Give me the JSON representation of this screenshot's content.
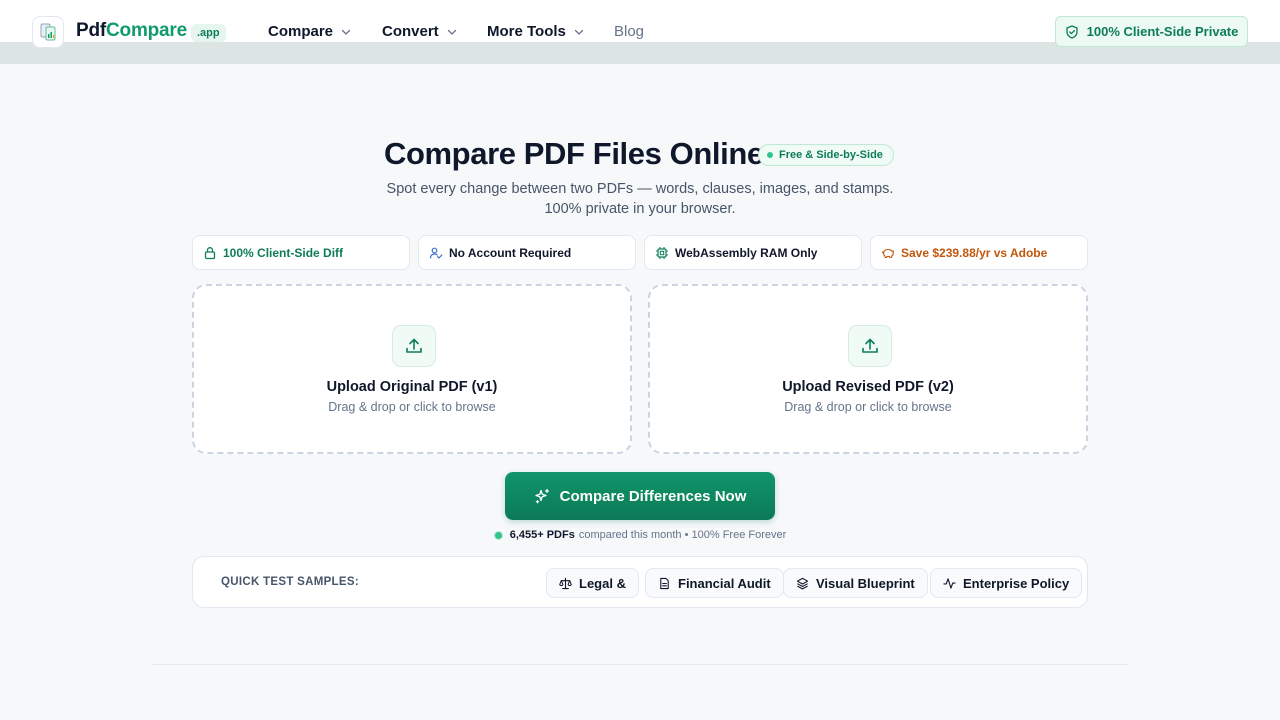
{
  "header": {
    "brand_part1": "Pdf",
    "brand_part2": "Compare",
    "brand_tag": ".app",
    "nav": [
      {
        "label": "Compare"
      },
      {
        "label": "Convert"
      },
      {
        "label": "More Tools"
      },
      {
        "label": "Blog"
      }
    ],
    "privacy_badge": "100% Client-Side Private"
  },
  "hero": {
    "title": "Compare PDF Files Online",
    "badge": "Free & Side-by-Side",
    "subtitle_line1": "Spot every change between two PDFs — words, clauses, images, and stamps.",
    "subtitle_line2": "100% private in your browser."
  },
  "features": [
    {
      "label": "100% Client-Side Diff",
      "color": "#0d7c58",
      "icon": "lock-icon"
    },
    {
      "label": "No Account Required",
      "color": "#0f172a",
      "icon": "user-check-icon"
    },
    {
      "label": "WebAssembly RAM Only",
      "color": "#0f172a",
      "icon": "chip-icon"
    },
    {
      "label": "Save $239.88/yr vs Adobe",
      "color": "#c2570c",
      "icon": "piggy-bank-icon"
    }
  ],
  "uploads": {
    "original": {
      "title": "Upload Original PDF (v1)",
      "hint": "Drag & drop or click to browse"
    },
    "revised": {
      "title": "Upload Revised PDF (v2)",
      "hint": "Drag & drop or click to browse"
    }
  },
  "cta": {
    "label": "Compare Differences Now"
  },
  "stats": {
    "count": "6,455+ PDFs",
    "text": "compared this month • 100% Free Forever"
  },
  "samples": {
    "label": "QUICK TEST SAMPLES:",
    "items": [
      {
        "label": "Legal &",
        "icon": "scale-icon"
      },
      {
        "label": "Financial Audit",
        "icon": "document-icon"
      },
      {
        "label": "Visual Blueprint",
        "icon": "layers-icon"
      },
      {
        "label": "Enterprise Policy",
        "icon": "activity-icon"
      }
    ]
  },
  "colors": {
    "accent": "#0f9b6e",
    "accent_dark": "#0b7a56",
    "warning": "#c2570c"
  }
}
